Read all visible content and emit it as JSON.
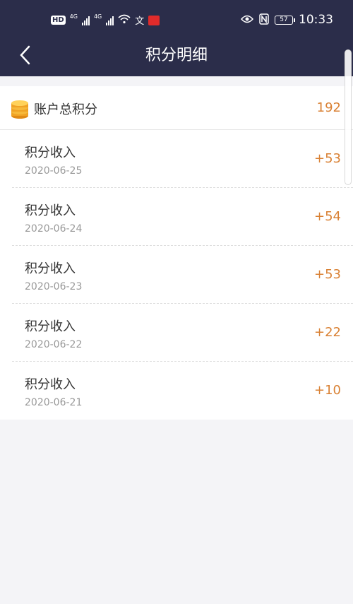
{
  "status_bar": {
    "hd": "HD",
    "sim1": "1",
    "net1": "4G",
    "net2": "4G",
    "battery": "57",
    "time": "10:33"
  },
  "nav": {
    "title": "积分明细",
    "back_icon": "chevron-left-icon"
  },
  "summary": {
    "label": "账户总积分",
    "value": "192",
    "icon": "coin-stack-icon"
  },
  "records": [
    {
      "title": "积分收入",
      "date": "2020-06-25",
      "points": "+53"
    },
    {
      "title": "积分收入",
      "date": "2020-06-24",
      "points": "+54"
    },
    {
      "title": "积分收入",
      "date": "2020-06-23",
      "points": "+53"
    },
    {
      "title": "积分收入",
      "date": "2020-06-22",
      "points": "+22"
    },
    {
      "title": "积分收入",
      "date": "2020-06-21",
      "points": "+10"
    }
  ],
  "colors": {
    "header_bg": "#2b2d4a",
    "accent": "#d98134",
    "page_bg": "#f4f4f7"
  }
}
